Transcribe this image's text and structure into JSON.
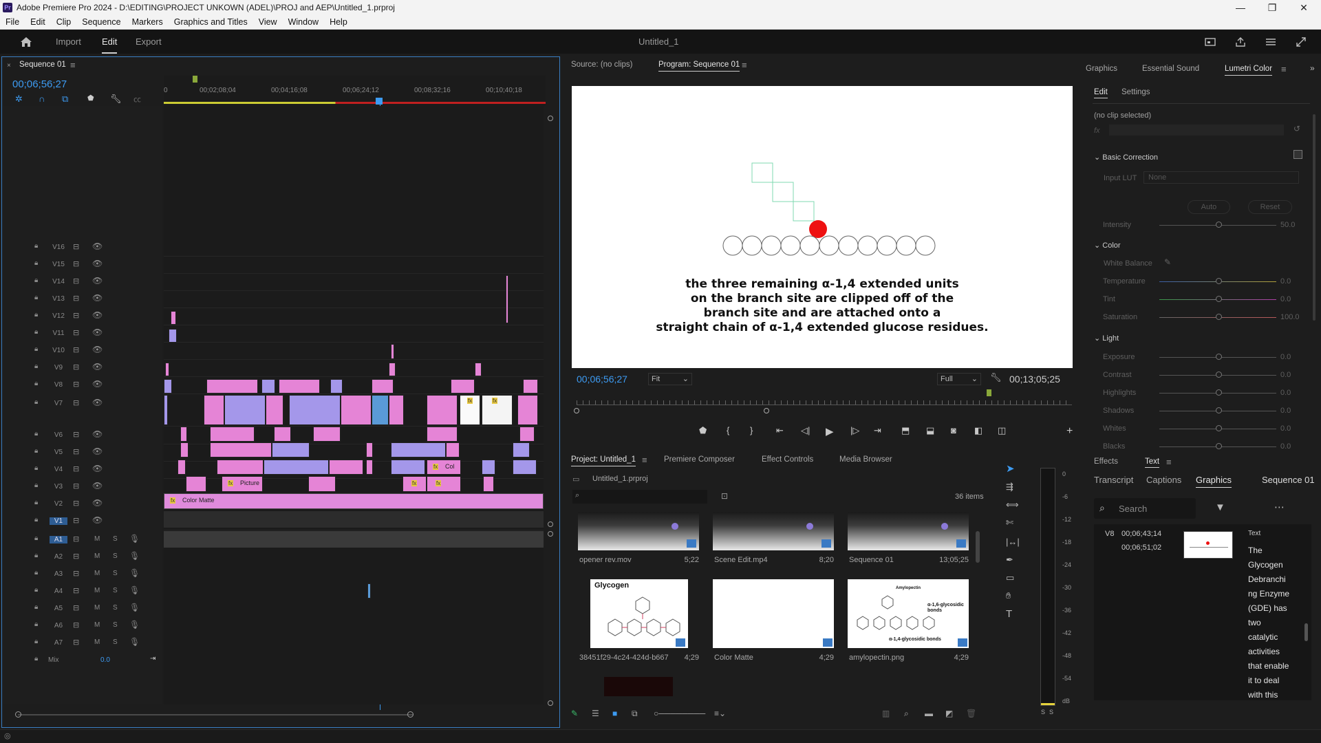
{
  "window": {
    "title": "Adobe Premiere Pro 2024 - D:\\EDITING\\PROJECT UNKOWN (ADEL)\\PROJ and AEP\\Untitled_1.prproj",
    "app_badge": "Pr",
    "minimize": "—",
    "maximize": "❐",
    "close": "✕"
  },
  "menu": [
    "File",
    "Edit",
    "Clip",
    "Sequence",
    "Markers",
    "Graphics and Titles",
    "View",
    "Window",
    "Help"
  ],
  "workspace": {
    "tabs": [
      "Import",
      "Edit",
      "Export"
    ],
    "active": "Edit",
    "project_title": "Untitled_1"
  },
  "timeline": {
    "tab": "Sequence 01",
    "timecode": "00;06;56;27",
    "ruler": [
      "0",
      "00;02;08;04",
      "00;04;16;08",
      "00;06;24;12",
      "00;08;32;16",
      "00;10;40;18"
    ],
    "video_tracks": [
      "V16",
      "V15",
      "V14",
      "V13",
      "V12",
      "V11",
      "V10",
      "V9",
      "V8",
      "V7",
      "V6",
      "V5",
      "V4",
      "V3",
      "V2",
      "V1"
    ],
    "audio_tracks": [
      "A1",
      "A2",
      "A3",
      "A4",
      "A5",
      "A6",
      "A7"
    ],
    "mix_label": "Mix",
    "mix_value": "0.0",
    "clip_labels": {
      "color_matte": "Color Matte",
      "picture": "Picture",
      "col": "Col"
    },
    "m_label": "M",
    "s_label": "S"
  },
  "monitor": {
    "source_tab": "Source: (no clips)",
    "program_tab": "Program: Sequence 01",
    "caption_lines": [
      "the three remaining α-1,4 extended units",
      "on the branch site are clipped off of the",
      "branch site and are attached onto a",
      "straight chain of α-1,4 extended glucose residues."
    ],
    "current_tc": "00;06;56;27",
    "fit": "Fit",
    "quality": "Full",
    "duration_tc": "00;13;05;25"
  },
  "project": {
    "tabs": [
      "Project: Untitled_1",
      "Premiere Composer",
      "Effect Controls",
      "Media Browser"
    ],
    "file": "Untitled_1.prproj",
    "items_count": "36 items",
    "items": [
      {
        "name": "opener rev.mov",
        "duration": "5;22"
      },
      {
        "name": "Scene Edit.mp4",
        "duration": "8;20"
      },
      {
        "name": "Sequence 01",
        "duration": "13;05;25"
      },
      {
        "name": "38451f29-4c24-424d-b667-...",
        "duration": "4;29"
      },
      {
        "name": "Color Matte",
        "duration": "4;29"
      },
      {
        "name": "amylopectin.png",
        "duration": "4;29"
      }
    ],
    "thumb_glycogen_title": "Glycogen",
    "thumb_amylo_title": "Amylopectin",
    "thumb_amylo_label1": "α-1,6-glycosidic bonds",
    "thumb_amylo_label2": "α-1,4-glycosidic bonds"
  },
  "audio_meter": {
    "scale": [
      "0",
      "-6",
      "-12",
      "-18",
      "-24",
      "-30",
      "-36",
      "-42",
      "-48",
      "-54",
      "dB"
    ],
    "solo": [
      "S",
      "S"
    ]
  },
  "lumetri": {
    "top_tabs": [
      "Graphics",
      "Essential Sound",
      "Lumetri Color"
    ],
    "sub_tabs": [
      "Edit",
      "Settings"
    ],
    "no_clip": "(no clip selected)",
    "fx_label": "fx",
    "basic_correction": "Basic Correction",
    "input_lut_label": "Input LUT",
    "input_lut_value": "None",
    "auto": "Auto",
    "reset": "Reset",
    "intensity": {
      "label": "Intensity",
      "value": "50.0"
    },
    "color_section": "Color",
    "white_balance": "White Balance",
    "color_sliders": [
      {
        "label": "Temperature",
        "value": "0.0"
      },
      {
        "label": "Tint",
        "value": "0.0"
      },
      {
        "label": "Saturation",
        "value": "100.0"
      }
    ],
    "light_section": "Light",
    "light_sliders": [
      {
        "label": "Exposure",
        "value": "0.0"
      },
      {
        "label": "Contrast",
        "value": "0.0"
      },
      {
        "label": "Highlights",
        "value": "0.0"
      },
      {
        "label": "Shadows",
        "value": "0.0"
      },
      {
        "label": "Whites",
        "value": "0.0"
      },
      {
        "label": "Blacks",
        "value": "0.0"
      }
    ]
  },
  "text_panel": {
    "outer_tabs": [
      "Effects",
      "Text"
    ],
    "inner_tabs": [
      "Transcript",
      "Captions",
      "Graphics",
      "Sequence 01"
    ],
    "search_placeholder": "Search",
    "item": {
      "track": "V8",
      "tc_in": "00;06;43;14",
      "tc_out": "00;06;51;02",
      "type": "Text",
      "text_lines": [
        "The",
        "Glycogen",
        "Debranchi",
        "ng Enzyme",
        "(GDE) has",
        "two",
        "catalytic",
        "activities",
        "that enable",
        "it to deal",
        "with this"
      ]
    }
  }
}
